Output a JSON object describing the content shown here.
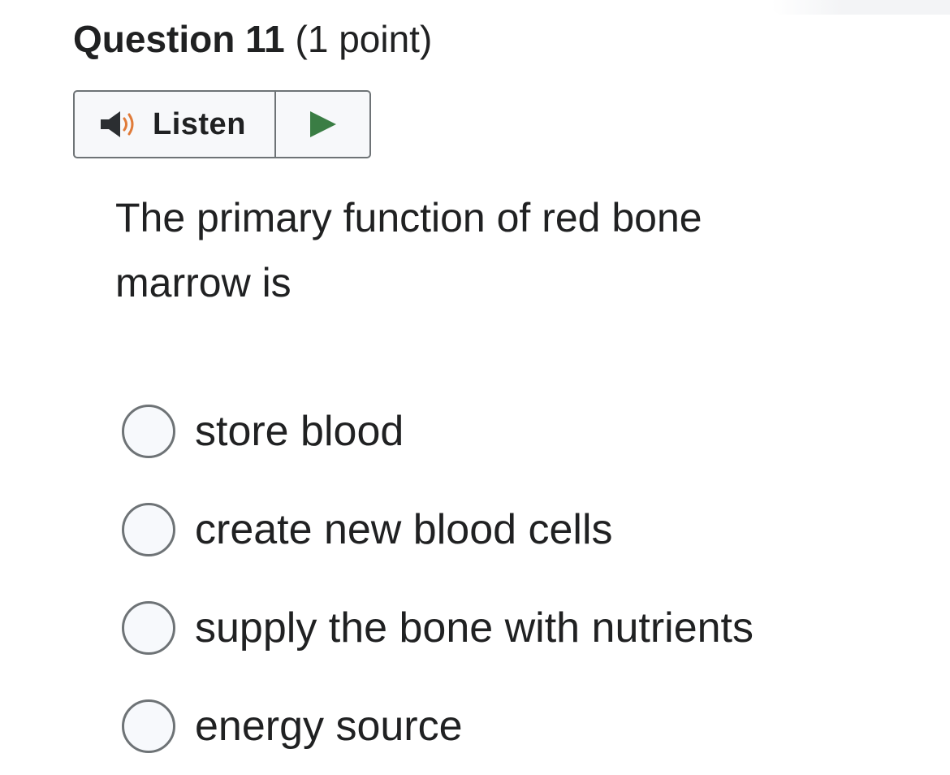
{
  "question": {
    "title": "Question 11",
    "points": "(1 point)",
    "text": "The primary function of red bone marrow is"
  },
  "listen": {
    "label": "Listen",
    "speaker_icon": "speaker-icon",
    "play_icon": "play-icon"
  },
  "colors": {
    "play_green": "#3a7d44",
    "speaker_orange": "#e07b39",
    "border_gray": "#6e7376",
    "text": "#202122"
  },
  "options": [
    {
      "label": "store blood",
      "selected": false
    },
    {
      "label": "create new blood cells",
      "selected": false
    },
    {
      "label": "supply the bone with nutrients",
      "selected": false
    },
    {
      "label": "energy source",
      "selected": false
    }
  ]
}
